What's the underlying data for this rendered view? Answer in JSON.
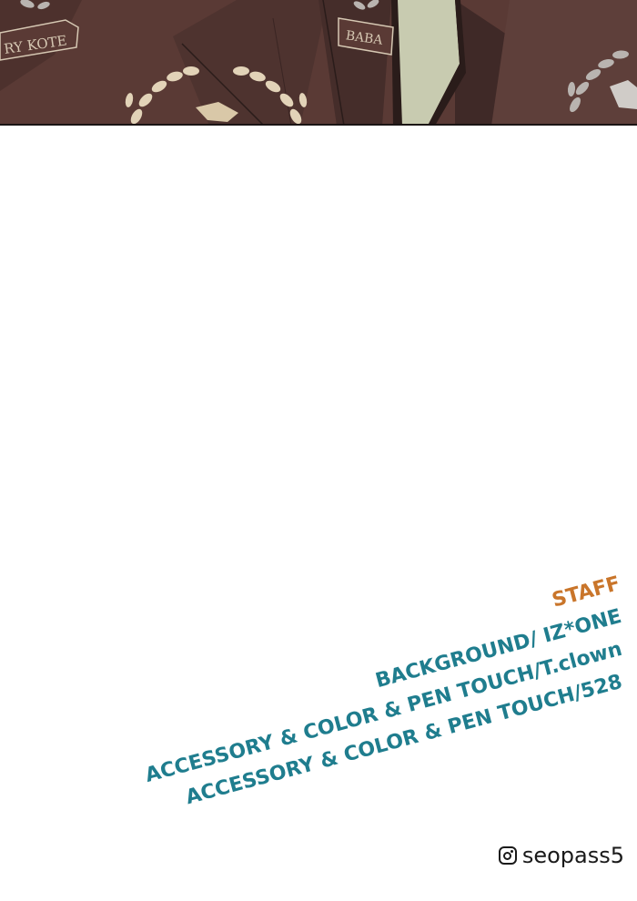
{
  "artwork": {
    "logo_text_left": "RY KOTE",
    "logo_text_center": "BABA",
    "colors": {
      "jacket": "#5a3a35",
      "jacket_dark": "#3f2927",
      "laurel_cream": "#e2d3b8",
      "laurel_gray": "#b9b4b0",
      "shirt": "#c8cbb0"
    }
  },
  "credits": {
    "heading": "STAFF",
    "lines": [
      "BACKGROUND/ IZ*ONE",
      "ACCESSORY & COLOR & PEN TOUCH/T.clown",
      "ACCESSORY & COLOR & PEN TOUCH/528"
    ],
    "colors": {
      "heading": "#c9752a",
      "lines": "#1f7d8e"
    }
  },
  "social": {
    "icon": "instagram-icon",
    "handle": "seopass5"
  }
}
